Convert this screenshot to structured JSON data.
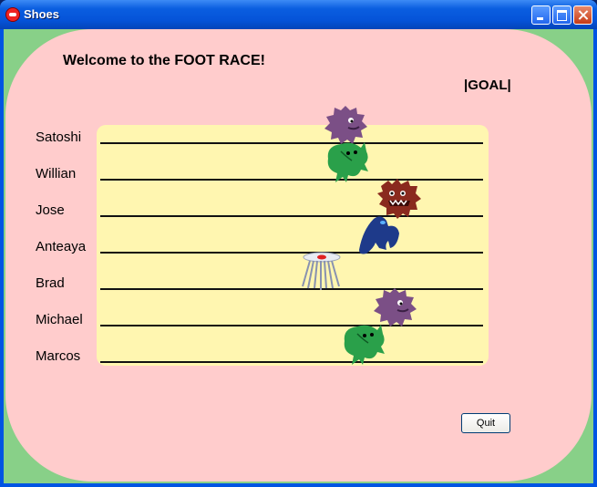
{
  "window": {
    "title": "Shoes"
  },
  "heading": "Welcome to the FOOT RACE!",
  "goal": "|GOAL|",
  "racers": [
    {
      "name": "Satoshi",
      "monster": "purple-fuzzy-monster-icon",
      "color": "#7b4f86"
    },
    {
      "name": "Willian",
      "monster": "green-blob-monster-icon",
      "color": "#2aa04a"
    },
    {
      "name": "Jose",
      "monster": "red-fuzzy-monster-icon",
      "color": "#8a2a1e"
    },
    {
      "name": "Anteaya",
      "monster": "blue-creature-icon",
      "color": "#1e3a8a"
    },
    {
      "name": "Brad",
      "monster": "jellyfish-icon",
      "color": "#aab4c8"
    },
    {
      "name": "Michael",
      "monster": "purple-fuzzy-monster-icon",
      "color": "#7b4f86"
    },
    {
      "name": "Marcos",
      "monster": "green-blob-monster-icon",
      "color": "#2aa04a"
    }
  ],
  "quit_label": "Quit"
}
